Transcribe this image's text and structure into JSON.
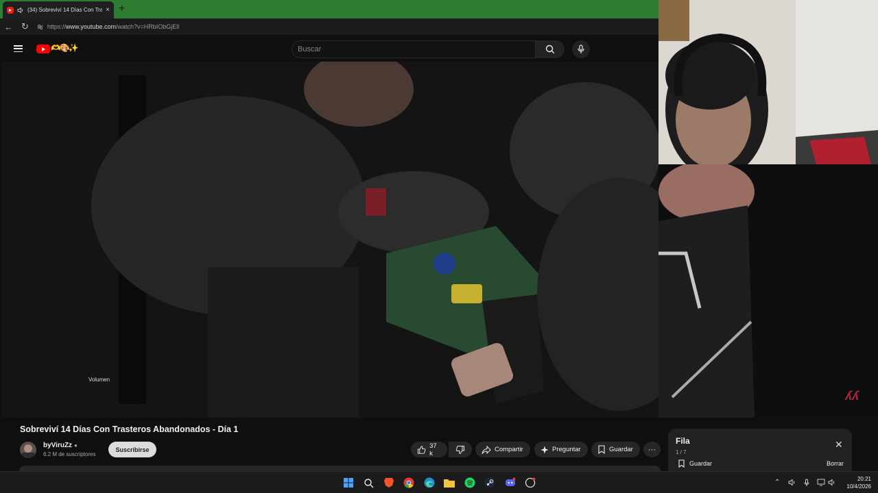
{
  "browser": {
    "tab_title": "(34) Sobreviví 14 Días Con Tra",
    "tab_close": "×",
    "new_tab": "+",
    "url_prefix": "https://",
    "url_host": "www.youtube.com",
    "url_path": "/watch?v=HRbIObGjEll"
  },
  "masthead": {
    "search_placeholder": "Buscar"
  },
  "player": {
    "volume_tooltip": "Volumen",
    "corner_logo": "ʎʎ"
  },
  "video": {
    "title": "Sobreviví 14 Días Con Trasteros Abandonados - Día 1",
    "channel_name": "byViruZz",
    "subscribers": "6.2 M de suscriptores",
    "subscribe_label": "Suscribirse",
    "likes": "37 k",
    "share_label": "Compartir",
    "ask_label": "Preguntar",
    "save_label": "Guardar",
    "more_label": "···"
  },
  "queue": {
    "title": "Fila",
    "count": "1 / 7",
    "save_label": "Guardar",
    "clear_label": "Borrar"
  },
  "taskbar": {
    "time": "20:21",
    "date": "10/4/2026"
  },
  "colors": {
    "tabbar_green": "#2e7d32",
    "youtube_red": "#ff0000",
    "background": "#0f0f0f",
    "pill": "#272727"
  }
}
